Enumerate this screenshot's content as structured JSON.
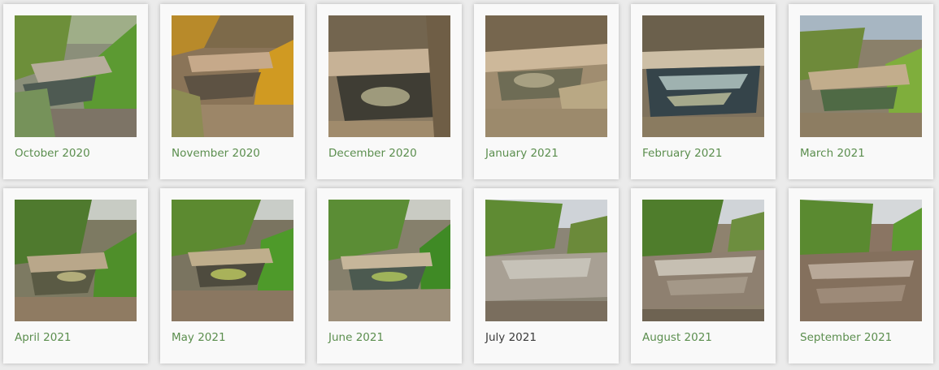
{
  "gallery": {
    "items": [
      {
        "caption": "October 2020",
        "scene": "green-pool",
        "caption_color": "#5b8e4e"
      },
      {
        "caption": "November 2020",
        "scene": "autumn-pool",
        "caption_color": "#5b8e4e"
      },
      {
        "caption": "December 2020",
        "scene": "bare-pool",
        "caption_color": "#5b8e4e"
      },
      {
        "caption": "January 2021",
        "scene": "dry-ledge",
        "caption_color": "#5b8e4e"
      },
      {
        "caption": "February 2021",
        "scene": "clear-pool",
        "caption_color": "#5b8e4e"
      },
      {
        "caption": "March 2021",
        "scene": "spring-pool",
        "caption_color": "#5b8e4e"
      },
      {
        "caption": "April 2021",
        "scene": "leafy-pool",
        "caption_color": "#5b8e4e"
      },
      {
        "caption": "May 2021",
        "scene": "mossy-pool",
        "caption_color": "#5b8e4e"
      },
      {
        "caption": "June 2021",
        "scene": "shaded-pool",
        "caption_color": "#5b8e4e"
      },
      {
        "caption": "July 2021",
        "scene": "muddy-flow",
        "caption_color": "#3a3a3a"
      },
      {
        "caption": "August 2021",
        "scene": "rushing-water",
        "caption_color": "#5b8e4e"
      },
      {
        "caption": "September 2021",
        "scene": "flood-water",
        "caption_color": "#5b8e4e"
      }
    ]
  }
}
